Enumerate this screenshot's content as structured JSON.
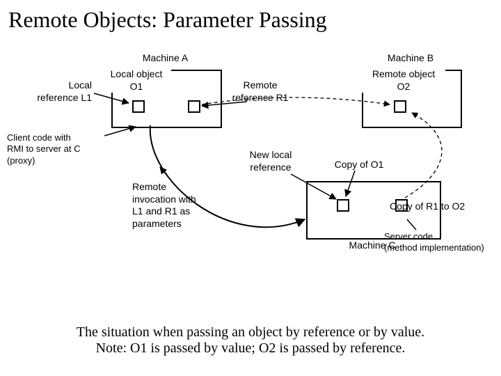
{
  "title": "Remote Objects: Parameter Passing",
  "machines": {
    "A": "Machine A",
    "B": "Machine B",
    "C": "Machine C"
  },
  "labels": {
    "local_ref_l1": "Local\nreference L1",
    "local_obj_o1": "Local object\nO1",
    "remote_ref_r1": "Remote\nreference R1",
    "remote_obj_o2": "Remote object\nO2",
    "client_code": "Client code with\nRMI to server at C\n(proxy)",
    "remote_invocation": "Remote\ninvocation with\nL1 and R1 as\nparameters",
    "new_local_ref": "New local\nreference",
    "copy_o1": "Copy of O1",
    "copy_r1_to_o2": "Copy of R1 to O2",
    "server_code": "Server code\n(method implementation)"
  },
  "caption_line1": "The situation when passing an object by reference or by value.",
  "caption_line2": "Note: O1 is passed by value; O2 is passed by reference."
}
